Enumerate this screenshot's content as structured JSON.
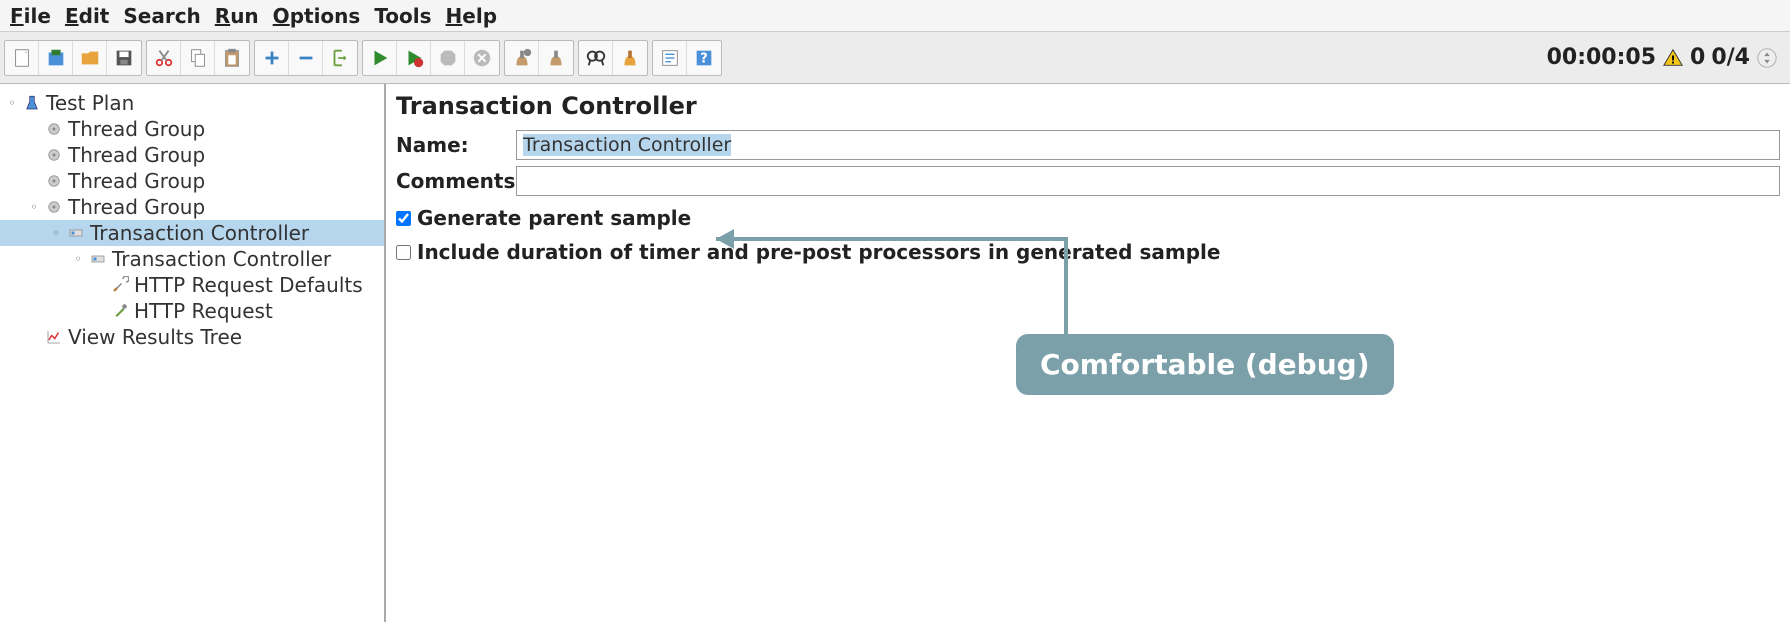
{
  "menu": {
    "file": "File",
    "edit": "Edit",
    "search": "Search",
    "run": "Run",
    "options": "Options",
    "tools": "Tools",
    "help": "Help"
  },
  "status": {
    "time": "00:00:05",
    "warn_count": "0",
    "threads": "0/4"
  },
  "tree": {
    "test_plan": "Test Plan",
    "thread_group_1": "Thread Group",
    "thread_group_2": "Thread Group",
    "thread_group_3": "Thread Group",
    "thread_group_4": "Thread Group",
    "transaction_controller_1": "Transaction Controller",
    "transaction_controller_2": "Transaction Controller",
    "http_request_defaults": "HTTP Request Defaults",
    "http_request": "HTTP Request",
    "view_results_tree": "View Results Tree"
  },
  "panel": {
    "title": "Transaction Controller",
    "name_label": "Name:",
    "name_value": "Transaction Controller",
    "comments_label": "Comments:",
    "comments_value": "",
    "generate_label": "Generate parent sample",
    "include_label": "Include duration of timer and pre-post processors in generated sample"
  },
  "annotation": {
    "text": "Comfortable (debug)"
  }
}
